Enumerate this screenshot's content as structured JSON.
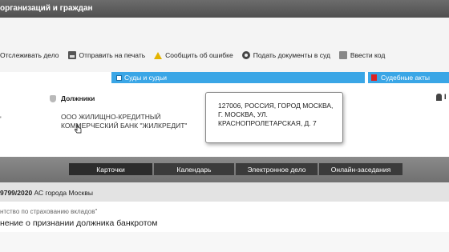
{
  "header": {
    "title": "организаций и граждан"
  },
  "toolbar": {
    "track": "Отслеживать дело",
    "print": "Отправить на печать",
    "report": "Сообщить об ошибке",
    "submit": "Подать документы в суд",
    "code": "Ввести код"
  },
  "tabs": {
    "courts": "Суды и судьи",
    "acts": "Судебные акты"
  },
  "case_info": {
    "left_marker": "'",
    "debtors_heading": "Должники",
    "debtor_name": "ООО ЖИЛИЩНО-КРЕДИТНЫЙ КОММЕРЧЕСКИЙ БАНК \"ЖИЛКРЕДИТ\"",
    "right_heading": "І"
  },
  "tooltip": {
    "address": "127006, РОССИЯ, ГОРОД МОСКВА, Г. МОСКВА, УЛ. КРАСНОПРОЛЕТАРСКАЯ, Д. 7"
  },
  "nav": {
    "cards": "Карточки",
    "calendar": "Календарь",
    "edelo": "Электронное дело",
    "online": "Онлайн-заседания"
  },
  "case": {
    "number": "9799/2020",
    "court": " АС города Москвы"
  },
  "details": {
    "party": "нтство по страхованию вкладов\"",
    "claim": "нение о признании должника банкротом"
  }
}
